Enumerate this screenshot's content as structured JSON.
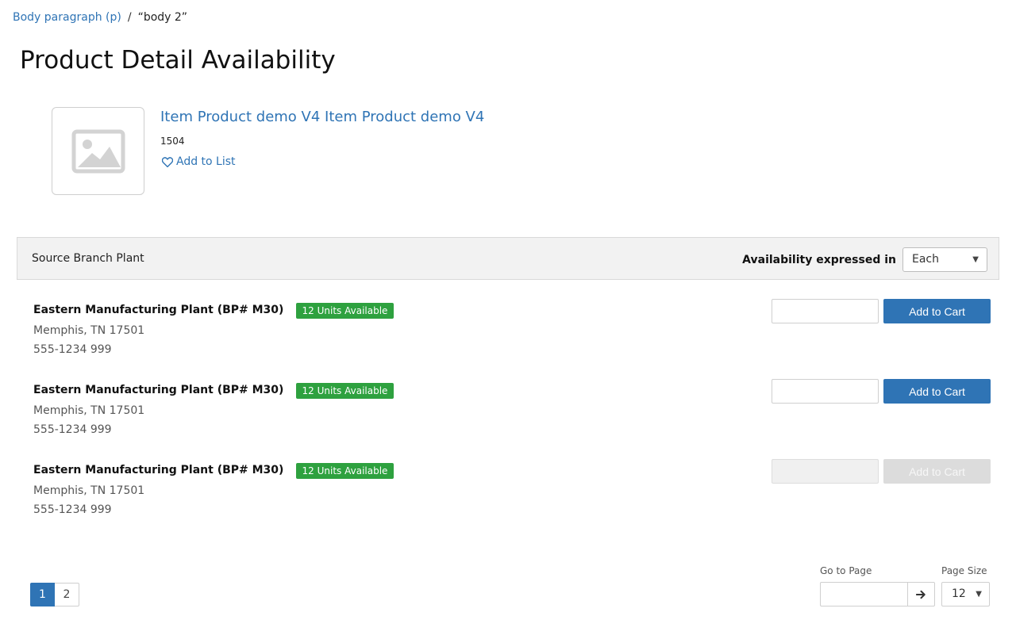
{
  "breadcrumb": {
    "link": "Body paragraph (p)",
    "separator": "/",
    "current": "“body 2”"
  },
  "page": {
    "title": "Product Detail Availability"
  },
  "product": {
    "image_icon": "image-placeholder-icon",
    "title": "Item Product demo V4 Item Product demo V4",
    "sku": "1504",
    "add_to_list": "Add to List",
    "add_to_list_icon": "heart-outline-icon"
  },
  "availability_header": {
    "source_label": "Source Branch Plant",
    "expressed_label": "Availability expressed in",
    "uom_value": "Each"
  },
  "branches": [
    {
      "name": "Eastern Manufacturing Plant (BP# M30)",
      "city": "Memphis, TN 17501",
      "phone": "555-1234 999",
      "badge": "12 Units Available",
      "cart_label": "Add to Cart",
      "enabled": true
    },
    {
      "name": "Eastern Manufacturing Plant (BP# M30)",
      "city": "Memphis, TN 17501",
      "phone": "555-1234 999",
      "badge": "12 Units Available",
      "cart_label": "Add to Cart",
      "enabled": true
    },
    {
      "name": "Eastern Manufacturing Plant (BP# M30)",
      "city": "Memphis, TN 17501",
      "phone": "555-1234 999",
      "badge": "12 Units Available",
      "cart_label": "Add to Cart",
      "enabled": false
    }
  ],
  "pagination": {
    "pages": [
      "1",
      "2"
    ],
    "active_page": "1",
    "goto_label": "Go to Page",
    "goto_icon": "arrow-right-icon",
    "size_label": "Page Size",
    "size_value": "12"
  },
  "colors": {
    "link": "#2f74b5",
    "primary": "#2f74b5",
    "success": "#2ea13f",
    "disabled": "#dcdcdc"
  }
}
